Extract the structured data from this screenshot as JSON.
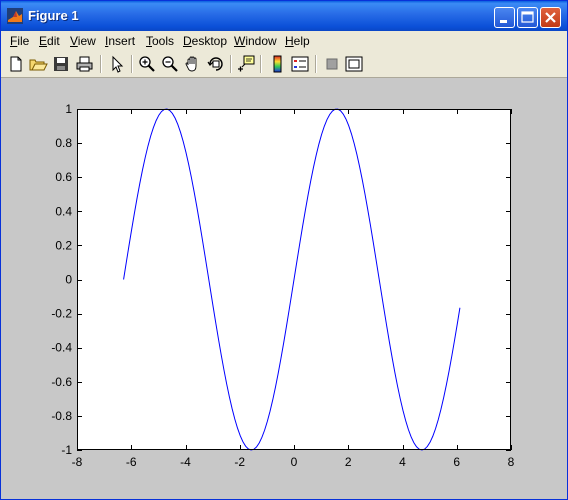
{
  "window": {
    "title": "Figure 1"
  },
  "titlebar_buttons": [
    "minimize-icon",
    "maximize-icon",
    "close-icon"
  ],
  "menu": [
    {
      "label": "File",
      "underline": "F",
      "rest": "ile"
    },
    {
      "label": "Edit",
      "underline": "E",
      "rest": "dit"
    },
    {
      "label": "View",
      "underline": "V",
      "rest": "iew"
    },
    {
      "label": "Insert",
      "underline": "I",
      "rest": "nsert"
    },
    {
      "label": "Tools",
      "underline": "T",
      "rest": "ools"
    },
    {
      "label": "Desktop",
      "underline": "D",
      "rest": "esktop"
    },
    {
      "label": "Window",
      "underline": "W",
      "rest": "indow"
    },
    {
      "label": "Help",
      "underline": "H",
      "rest": "elp"
    }
  ],
  "toolbar_icons": [
    "new-figure-icon",
    "open-file-icon",
    "save-icon",
    "print-icon",
    "edit-plot-icon",
    "zoom-in-icon",
    "zoom-out-icon",
    "pan-icon",
    "rotate-3d-icon",
    "data-cursor-icon",
    "insert-colorbar-icon",
    "insert-legend-icon",
    "hide-plot-tools-icon",
    "show-plot-tools-icon"
  ],
  "colors": {
    "line": "#0000ff",
    "figure_background": "#c8c8c8",
    "axes_background": "#ffffff"
  },
  "chart_data": {
    "type": "line",
    "function": "sin(x)",
    "title": "",
    "xlabel": "",
    "ylabel": "",
    "xlim": [
      -8,
      8
    ],
    "ylim": [
      -1,
      1
    ],
    "x_ticks": [
      "-8",
      "-6",
      "-4",
      "-2",
      "0",
      "2",
      "4",
      "6",
      "8"
    ],
    "y_ticks": [
      "-1",
      "-0.8",
      "-0.6",
      "-0.4",
      "-0.2",
      "0",
      "0.2",
      "0.4",
      "0.6",
      "0.8",
      "1"
    ],
    "grid": false,
    "series": [
      {
        "x_start": -6.2832,
        "x_end": 6.2,
        "x_step": 0.1,
        "color": "#0000ff"
      }
    ]
  }
}
